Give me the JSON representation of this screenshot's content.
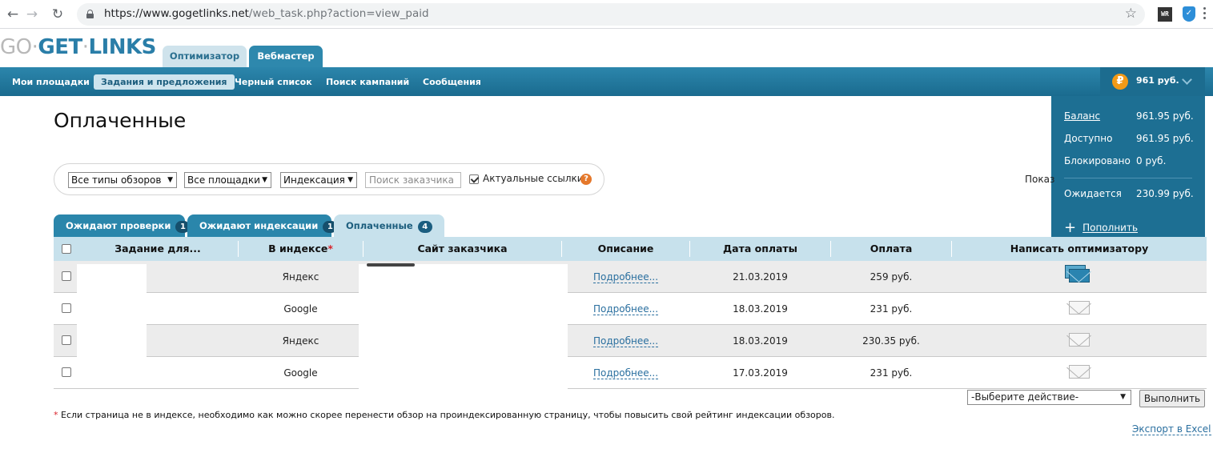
{
  "browser": {
    "url_host": "https://www.gogetlinks.net",
    "url_path": "/web_task.php?action=view_paid",
    "extension_label": "WR"
  },
  "logo": {
    "part1": "GO",
    "dot1": "·",
    "part2": "GET",
    "dot2": "·",
    "part3": "LINKS"
  },
  "roles": {
    "optimizer": "Оптимизатор",
    "webmaster": "Вебмастер"
  },
  "nav": {
    "items": [
      "Мои площадки",
      "Задания и предложения",
      "Черный список",
      "Поиск кампаний",
      "Сообщения"
    ],
    "balance_short": "961 руб."
  },
  "balance_menu": {
    "balance_label": "Баланс",
    "balance_value": "961.95 руб.",
    "available_label": "Доступно",
    "available_value": "961.95 руб.",
    "blocked_label": "Блокировано",
    "blocked_value": "0 руб.",
    "pending_label": "Ожидается",
    "pending_value": "230.99 руб.",
    "topup_label": "Пополнить"
  },
  "page": {
    "title": "Оплаченные"
  },
  "filters": {
    "review_types": "Все типы обзоров",
    "sites": "Все площадки",
    "indexing": "Индексация",
    "search_placeholder": "Поиск заказчика",
    "actual_links_label": "Актуальные ссылки",
    "show_label": "Показ"
  },
  "tabs": [
    {
      "label": "Ожидают проверки",
      "count": "1"
    },
    {
      "label": "Ожидают индексации",
      "count": "1"
    },
    {
      "label": "Оплаченные",
      "count": "4"
    }
  ],
  "table": {
    "headers": {
      "task": "Задание для...",
      "indexed": "В индексе",
      "required_mark": "*",
      "customer_site": "Сайт заказчика",
      "description": "Описание",
      "pay_date": "Дата оплаты",
      "payment": "Оплата",
      "write_optimizer": "Написать оптимизатору"
    },
    "rows": [
      {
        "indexed": "Яндекс",
        "description": "Подробнее...",
        "pay_date": "21.03.2019",
        "payment": "259 руб.",
        "mail": "new-message"
      },
      {
        "indexed": "Google",
        "description": "Подробнее...",
        "pay_date": "18.03.2019",
        "payment": "231 руб.",
        "mail": "message"
      },
      {
        "indexed": "Яндекс",
        "description": "Подробнее...",
        "pay_date": "18.03.2019",
        "payment": "230.35 руб.",
        "mail": "message"
      },
      {
        "indexed": "Google",
        "description": "Подробнее...",
        "pay_date": "17.03.2019",
        "payment": "231 руб.",
        "mail": "message"
      }
    ]
  },
  "actions": {
    "select_value": "-Выберите действие-",
    "run_label": "Выполнить"
  },
  "footnote": {
    "star": "*",
    "text": " Если страница не в индексе, необходимо как можно скорее перенести обзор на проиндексированную страницу, чтобы повысить свой рейтинг индексации обзоров."
  },
  "export_label": "Экспорт в Excel",
  "colors": {
    "brand": "#2a86ab",
    "nav_dark": "#1a6b8f",
    "accent_orange": "#f29a17"
  }
}
